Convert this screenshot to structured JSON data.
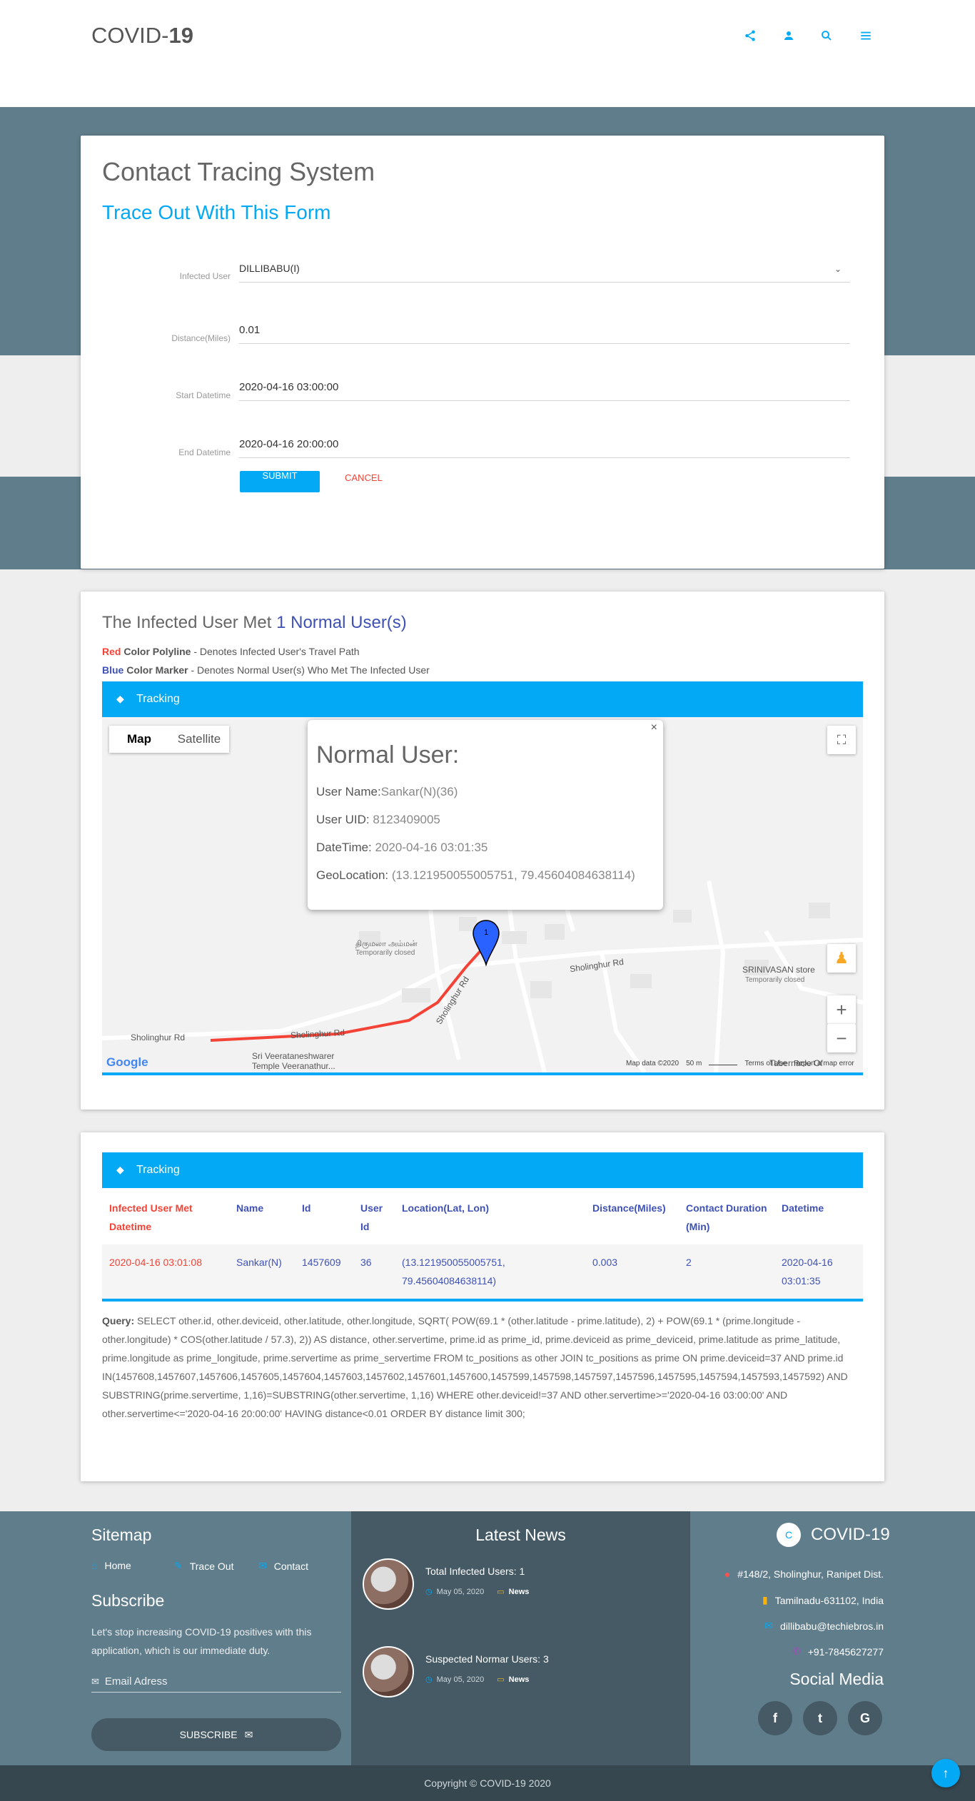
{
  "header": {
    "brand_prefix": "COVID-",
    "brand_number": "19",
    "icons": [
      "share-icon",
      "person-icon",
      "search-icon",
      "menu-icon"
    ]
  },
  "form": {
    "title": "Contact Tracing System",
    "subtitle": "Trace Out With This Form",
    "fields": [
      {
        "label": "Infected User",
        "value": "DILLIBABU(I)"
      },
      {
        "label": "Distance(Miles)",
        "value": "0.01"
      },
      {
        "label": "Start Datetime",
        "value": "2020-04-16 03:00:00"
      },
      {
        "label": "End Datetime",
        "value": "2020-04-16 20:00:00"
      }
    ],
    "submit_label": "SUBMIT",
    "cancel_label": "CANCEL"
  },
  "map_section": {
    "title_prefix": "The Infected User Met ",
    "title_highlight": "1 Normal User(s)",
    "legend_red_bold": "Red",
    "legend_red_rest": " Color Polyline",
    "legend_red_desc": " - Denotes Infected User's Travel Path",
    "legend_blue_bold": "Blue",
    "legend_blue_rest": " Color Marker",
    "legend_blue_desc": " - Denotes Normal User(s) Who Met The Infected User",
    "bar_title": "Tracking",
    "map_tab": "Map",
    "satellite_tab": "Satellite",
    "popup": {
      "title": "Normal User:",
      "name_label": "User Name:",
      "name_value": "Sankar(N)(36)",
      "uid_label": "User UID: ",
      "uid_value": "8123409005",
      "dt_label": "DateTime: ",
      "dt_value": "2020-04-16 03:01:35",
      "geo_label": "GeoLocation: ",
      "geo_value": "(13.121950055005751, 79.45604084638114)"
    },
    "marker_label": "1",
    "labels": {
      "road1": "Sholinghur Rd",
      "road2": "Sholinghur Rd",
      "road3": "Sholinghur Rd",
      "road4": "Sholinghur Rd",
      "place1": "திருமலா அம்மன்",
      "place1b": "Temporarily closed",
      "store": "SRINIVASAN store",
      "store_sub": "Temporarily closed",
      "temple1": "Sri Veerataneshwarer",
      "temple2": "Temple Veeranathur...",
      "tabernacle": "Tabernacle Of",
      "google": "Google",
      "mapdata": "Map data ©2020",
      "scale": "50 m",
      "terms": "Terms of Use",
      "report": "Report a map error"
    },
    "colors": {
      "polyline": "#f44336",
      "marker": "#3f51b5"
    }
  },
  "table_section": {
    "bar_title": "Tracking",
    "headers": [
      "Infected User Met Datetime",
      "Name",
      "Id",
      "User Id",
      "Location(Lat, Lon)",
      "Distance(Miles)",
      "Contact Duration (Min)",
      "Datetime"
    ],
    "rows": [
      [
        "2020-04-16 03:01:08",
        "Sankar(N)",
        "1457609",
        "36",
        "(13.121950055005751, 79.45604084638114)",
        "0.003",
        "2",
        "2020-04-16 03:01:35"
      ]
    ],
    "query_label": "Query:",
    "query_text": " SELECT other.id, other.deviceid, other.latitude, other.longitude, SQRT( POW(69.1 * (other.latitude - prime.latitude), 2) + POW(69.1 * (prime.longitude - other.longitude) * COS(other.latitude / 57.3), 2)) AS distance, other.servertime, prime.id as prime_id, prime.deviceid as prime_deviceid, prime.latitude as prime_latitude, prime.longitude as prime_longitude, prime.servertime as prime_servertime FROM tc_positions as other JOIN tc_positions as prime ON prime.deviceid=37 AND prime.id IN(1457608,1457607,1457606,1457605,1457604,1457603,1457602,1457601,1457600,1457599,1457598,1457597,1457596,1457595,1457594,1457593,1457592) AND SUBSTRING(prime.servertime, 1,16)=SUBSTRING(other.servertime, 1,16) WHERE other.deviceid!=37 AND other.servertime>='2020-04-16 03:00:00' AND other.servertime<='2020-04-16 20:00:00' HAVING distance<0.01 ORDER BY distance limit 300;"
  },
  "footer": {
    "sitemap_title": "Sitemap",
    "links": [
      "Home",
      "Trace Out",
      "Contact"
    ],
    "subscribe_title": "Subscribe",
    "subscribe_text": "Let's stop increasing COVID-19 positives with this application, which is our immediate duty.",
    "email_placeholder": "Email Adress",
    "subscribe_button": "SUBSCRIBE",
    "news_title": "Latest News",
    "news": [
      {
        "title": "Total Infected Users: 1",
        "date": "May 05, 2020",
        "tag": "News"
      },
      {
        "title": "Suspected Normar Users: 3",
        "date": "May 05, 2020",
        "tag": "News"
      }
    ],
    "brand_logo_letter": "C",
    "brand_prefix": "COVID-",
    "brand_number": "19",
    "address1": "#148/2, Sholinghur, Ranipet Dist.",
    "address2": "Tamilnadu-631102, India",
    "email": "dillibabu@techiebros.in",
    "phone": "+91-7845627277",
    "social_title": "Social Media",
    "social": [
      "f",
      "t",
      "G"
    ],
    "copyright": "Copyright © COVID-19 2020"
  }
}
